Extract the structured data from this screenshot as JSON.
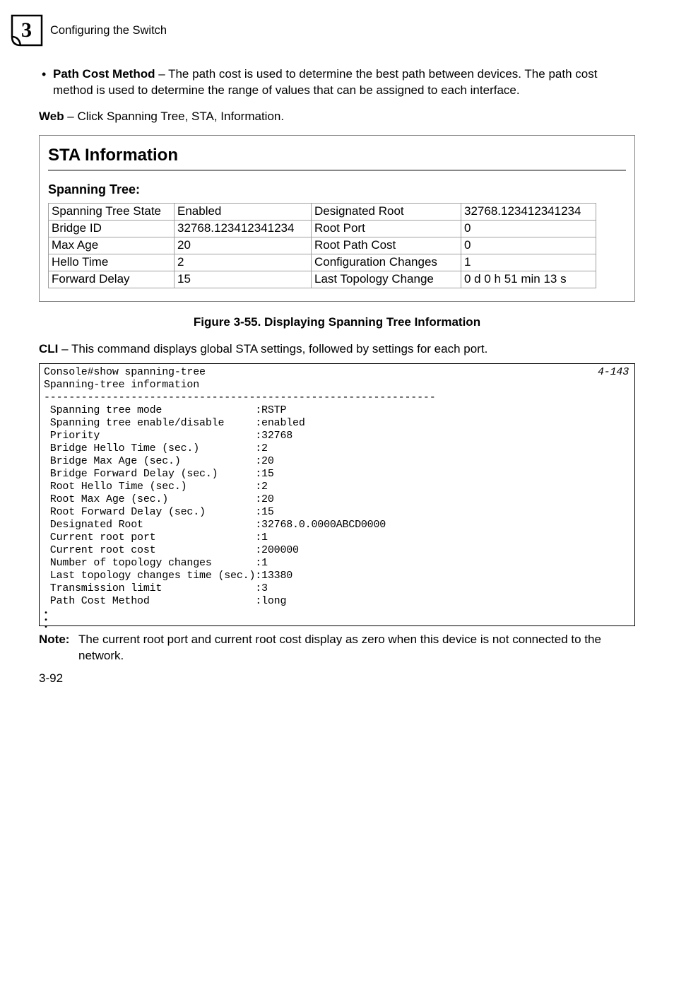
{
  "header": {
    "chapter_number": "3",
    "chapter_title": "Configuring the Switch"
  },
  "bullet": {
    "term": "Path Cost Method",
    "rest": " – The path cost is used to determine the best path between devices. The path cost method is used to determine the range of values that can be assigned to each interface."
  },
  "web": {
    "label": "Web",
    "text": " – Click Spanning Tree, STA, Information."
  },
  "sta_box": {
    "title": "STA Information",
    "subtitle": "Spanning Tree:",
    "rows": [
      [
        "Spanning Tree State",
        "Enabled",
        "Designated Root",
        "32768.123412341234"
      ],
      [
        "Bridge ID",
        "32768.123412341234",
        "Root Port",
        "0"
      ],
      [
        "Max Age",
        "20",
        "Root Path Cost",
        "0"
      ],
      [
        "Hello Time",
        "2",
        "Configuration Changes",
        "1"
      ],
      [
        "Forward Delay",
        "15",
        "Last Topology Change",
        "0 d 0 h 51 min 13 s"
      ]
    ]
  },
  "figure_caption": "Figure 3-55.  Displaying Spanning Tree Information",
  "cli": {
    "label": "CLI",
    "text": " – This command displays global STA settings, followed by settings for each port.",
    "ref": "4-143",
    "body": "Console#show spanning-tree\nSpanning-tree information\n---------------------------------------------------------------\n Spanning tree mode               :RSTP\n Spanning tree enable/disable     :enabled\n Priority                         :32768\n Bridge Hello Time (sec.)         :2\n Bridge Max Age (sec.)            :20\n Bridge Forward Delay (sec.)      :15\n Root Hello Time (sec.)           :2\n Root Max Age (sec.)              :20\n Root Forward Delay (sec.)        :15\n Designated Root                  :32768.0.0000ABCD0000\n Current root port                :1\n Current root cost                :200000\n Number of topology changes       :1\n Last topology changes time (sec.):13380\n Transmission limit               :3\n Path Cost Method                 :long"
  },
  "note": {
    "label": "Note:",
    "text": "The current root port and current root cost display as zero when this device is not connected to the network."
  },
  "page_number": "3-92"
}
